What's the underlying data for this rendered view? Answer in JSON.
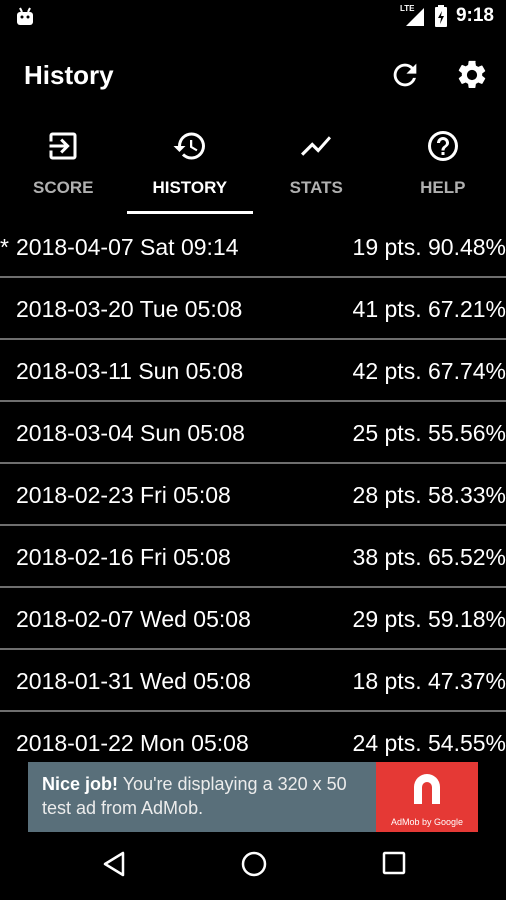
{
  "status_bar": {
    "network": "LTE",
    "time": "9:18"
  },
  "app_bar": {
    "title": "History",
    "actions": [
      "refresh-icon",
      "settings-icon"
    ]
  },
  "tabs": [
    {
      "label": "SCORE",
      "icon": "login-icon",
      "active": false
    },
    {
      "label": "HISTORY",
      "icon": "history-icon",
      "active": true
    },
    {
      "label": "STATS",
      "icon": "trending-icon",
      "active": false
    },
    {
      "label": "HELP",
      "icon": "help-icon",
      "active": false
    }
  ],
  "history": [
    {
      "marker": "*",
      "date": "2018-04-07 Sat 09:14",
      "score": "19 pts. 90.48%"
    },
    {
      "marker": "",
      "date": "2018-03-20 Tue 05:08",
      "score": "41 pts. 67.21%"
    },
    {
      "marker": "",
      "date": "2018-03-11 Sun 05:08",
      "score": "42 pts. 67.74%"
    },
    {
      "marker": "",
      "date": "2018-03-04 Sun 05:08",
      "score": "25 pts. 55.56%"
    },
    {
      "marker": "",
      "date": "2018-02-23 Fri 05:08",
      "score": "28 pts. 58.33%"
    },
    {
      "marker": "",
      "date": "2018-02-16 Fri 05:08",
      "score": "38 pts. 65.52%"
    },
    {
      "marker": "",
      "date": "2018-02-07 Wed 05:08",
      "score": "29 pts. 59.18%"
    },
    {
      "marker": "",
      "date": "2018-01-31 Wed 05:08",
      "score": "18 pts. 47.37%"
    },
    {
      "marker": "",
      "date": "2018-01-22 Mon 05:08",
      "score": "24 pts. 54.55%"
    }
  ],
  "ad": {
    "headline": "Nice job!",
    "body": "You're displaying a 320 x 50 test ad from AdMob.",
    "brand": "AdMob by Google"
  },
  "colors": {
    "background": "#000000",
    "divider": "#6e6e6e",
    "ad_background": "#596f7a",
    "ad_logo": "#e53935"
  }
}
